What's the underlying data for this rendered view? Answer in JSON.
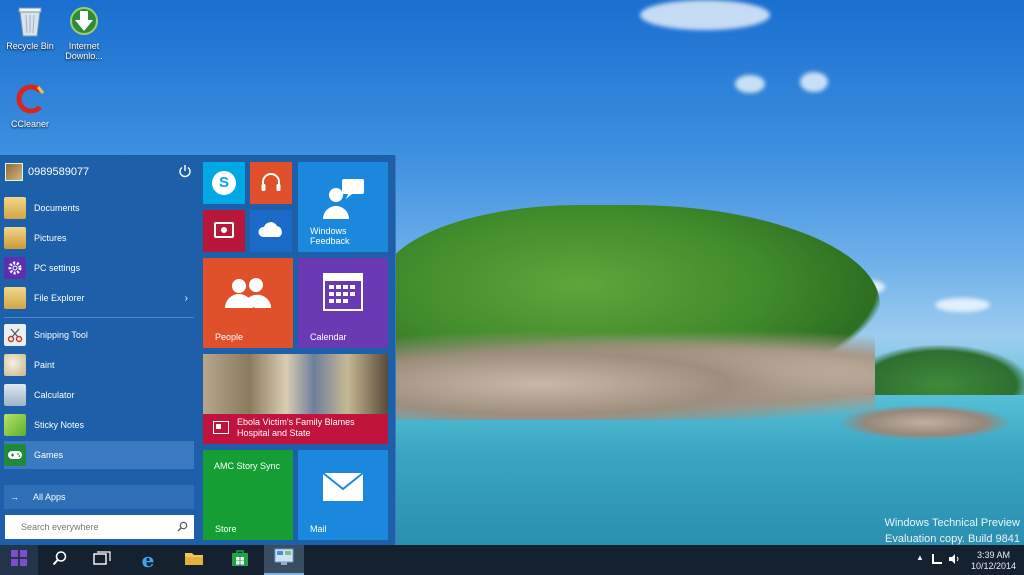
{
  "desktop": {
    "icons": [
      {
        "label": "Recycle Bin",
        "icon": "recycle-bin-icon"
      },
      {
        "label": "Internet Downlo...",
        "icon": "internet-download-manager-icon"
      },
      {
        "label": "CCleaner",
        "icon": "ccleaner-icon"
      }
    ],
    "watermark": {
      "line1": "Windows Technical Preview",
      "line2": "Evaluation copy. Build 9841"
    }
  },
  "start_menu": {
    "user": {
      "name": "0989589077",
      "icon": "user-avatar"
    },
    "power_icon": "power-icon",
    "places": [
      {
        "label": "Documents",
        "icon": "documents-folder-icon"
      },
      {
        "label": "Pictures",
        "icon": "pictures-folder-icon"
      },
      {
        "label": "PC settings",
        "icon": "gear-icon"
      },
      {
        "label": "File Explorer",
        "icon": "file-explorer-icon",
        "has_submenu": true
      }
    ],
    "apps": [
      {
        "label": "Snipping Tool",
        "icon": "scissors-icon"
      },
      {
        "label": "Paint",
        "icon": "paint-palette-icon"
      },
      {
        "label": "Calculator",
        "icon": "calculator-icon"
      },
      {
        "label": "Sticky Notes",
        "icon": "sticky-notes-icon"
      },
      {
        "label": "Games",
        "icon": "gamepad-icon",
        "selected": true
      }
    ],
    "all_apps": {
      "label": "All Apps",
      "icon": "arrow-right-icon"
    },
    "search": {
      "placeholder": "Search everywhere",
      "icon": "search-icon"
    },
    "tiles": {
      "skype": {
        "label": "",
        "icon": "skype-icon",
        "color": "#00a8e6"
      },
      "music": {
        "label": "",
        "icon": "headphones-icon",
        "color": "#e0512b"
      },
      "video": {
        "label": "",
        "icon": "video-icon",
        "color": "#b8163a"
      },
      "onedrive": {
        "label": "",
        "icon": "onedrive-cloud-icon",
        "color": "#1b6ac9"
      },
      "feedback": {
        "label": "Windows\nFeedback",
        "line1": "Windows",
        "line2": "Feedback",
        "icon": "feedback-people-icon",
        "color": "#1a88dd"
      },
      "people": {
        "label": "People",
        "icon": "people-icon",
        "color": "#e0512b"
      },
      "calendar": {
        "label": "Calendar",
        "icon": "calendar-icon",
        "color": "#6a3ab5"
      },
      "news": {
        "line1": "Ebola Victim's Family Blames",
        "line2": "Hospital and State",
        "icon": "news-icon",
        "color": "#c0143c"
      },
      "store": {
        "label": "Store",
        "headline": "AMC Story Sync",
        "icon": "store-icon",
        "color": "#159e33"
      },
      "mail": {
        "label": "Mail",
        "icon": "envelope-icon",
        "color": "#1a88dd"
      }
    }
  },
  "taskbar": {
    "buttons": [
      {
        "name": "start-button",
        "icon": "windows-logo-icon"
      },
      {
        "name": "search-button",
        "icon": "search-icon"
      },
      {
        "name": "task-view-button",
        "icon": "task-view-icon"
      },
      {
        "name": "internet-explorer-button",
        "icon": "internet-explorer-icon"
      },
      {
        "name": "file-explorer-button",
        "icon": "folder-icon"
      },
      {
        "name": "store-button",
        "icon": "store-icon"
      },
      {
        "name": "control-panel-button",
        "icon": "control-panel-icon"
      }
    ],
    "clock": {
      "time": "3:39 AM",
      "date": "10/12/2014"
    }
  },
  "colors": {
    "start_bg": "#1d5fa8",
    "taskbar_bg": "#15212e",
    "accent": "#3a7ac0"
  }
}
